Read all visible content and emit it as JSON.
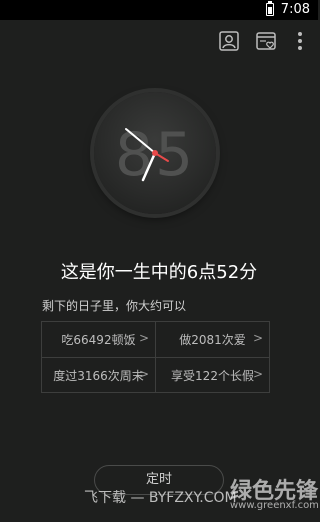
{
  "status_bar": {
    "time": "7:08"
  },
  "clock": {
    "number": "85"
  },
  "title": "这是你一生中的6点52分",
  "subtitle": "剩下的日子里，你大约可以",
  "grid": [
    {
      "label": "吃66492顿饭",
      "arrow": ">"
    },
    {
      "label": "做2081次爱",
      "arrow": ">"
    },
    {
      "label": "度过3166次周末",
      "arrow": ">"
    },
    {
      "label": "享受122个长假",
      "arrow": ">"
    }
  ],
  "bottom_button": {
    "label": "定时"
  },
  "watermark": {
    "left_text": "飞下载 — BYFZXY.COM",
    "brand_text": "绿色先锋",
    "brand_url": "www.greenxf.com"
  }
}
